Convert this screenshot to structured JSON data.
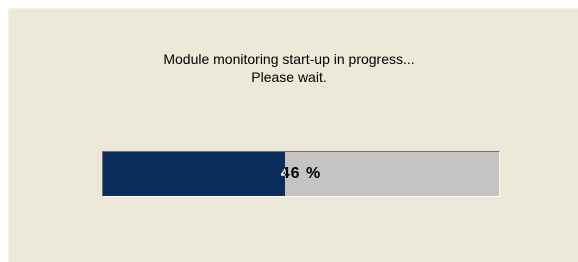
{
  "dialog": {
    "message_line1": "Module monitoring start-up in progress...",
    "message_line2": "Please wait."
  },
  "progress": {
    "percent": 46,
    "label": "46 %",
    "fill_color": "#0a2d5e",
    "track_color": "#c4c4c4"
  }
}
